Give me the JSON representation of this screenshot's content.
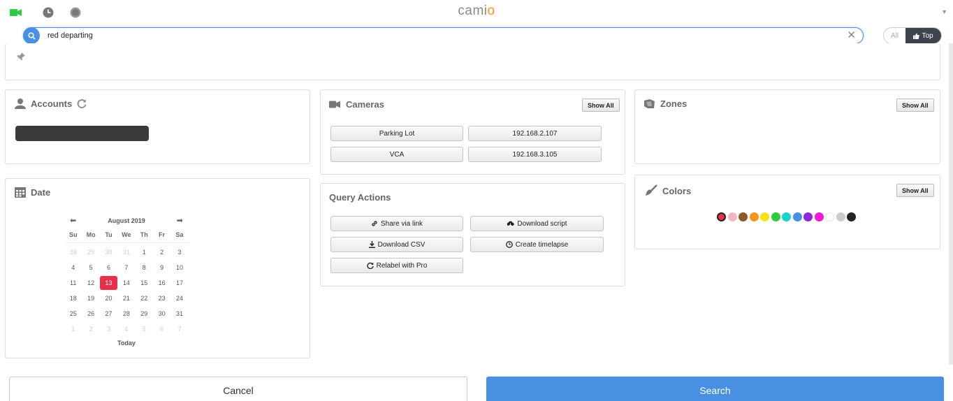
{
  "header": {
    "brand": "cami",
    "brand_o": "o"
  },
  "search": {
    "value": "red departing",
    "placeholder": ""
  },
  "toggle": {
    "all_label": "All",
    "top_label": "Top"
  },
  "accounts": {
    "title": "Accounts"
  },
  "cameras": {
    "title": "Cameras",
    "show_all": "Show All",
    "items": [
      "Parking Lot",
      "192.168.2.107",
      "VCA",
      "192.168.3.105"
    ]
  },
  "zones": {
    "title": "Zones",
    "show_all": "Show All"
  },
  "date": {
    "title": "Date",
    "month": "August 2019",
    "weekdays": [
      "Su",
      "Mo",
      "Tu",
      "We",
      "Th",
      "Fr",
      "Sa"
    ],
    "weeks": [
      [
        "28",
        "29",
        "30",
        "31",
        "1",
        "2",
        "3"
      ],
      [
        "4",
        "5",
        "6",
        "7",
        "8",
        "9",
        "10"
      ],
      [
        "11",
        "12",
        "13",
        "14",
        "15",
        "16",
        "17"
      ],
      [
        "18",
        "19",
        "20",
        "21",
        "22",
        "23",
        "24"
      ],
      [
        "25",
        "26",
        "27",
        "28",
        "29",
        "30",
        "31"
      ],
      [
        "1",
        "2",
        "3",
        "4",
        "5",
        "6",
        "7"
      ]
    ],
    "selected": "13",
    "today": "Today"
  },
  "query_actions": {
    "title": "Query Actions",
    "share": "Share via link",
    "download_script": "Download script",
    "download_csv": "Download CSV",
    "timelapse": "Create timelapse",
    "relabel": "Relabel with Pro"
  },
  "colors": {
    "title": "Colors",
    "show_all": "Show All",
    "swatches": [
      "#e8304a",
      "#f4b6c2",
      "#8b5a2b",
      "#f7941d",
      "#f5e11a",
      "#2ecc40",
      "#1fd1c8",
      "#4a90e2",
      "#8e2bd9",
      "#f01ad8",
      "#ffffff",
      "#cccccc",
      "#222222"
    ]
  },
  "footer": {
    "cancel": "Cancel",
    "search": "Search"
  }
}
